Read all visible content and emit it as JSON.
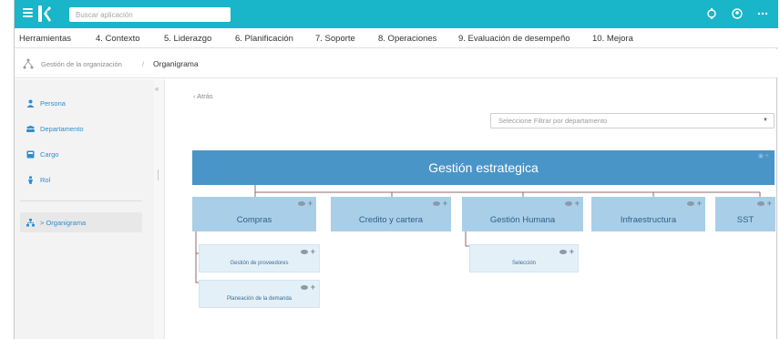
{
  "search": {
    "placeholder": "Buscar aplicación"
  },
  "nav": {
    "items": [
      "Herramientas",
      "4. Contexto",
      "5. Liderazgo",
      "6. Planificación",
      "7. Soporte",
      "8. Operaciones",
      "9. Evaluación de desempeño",
      "10. Mejora"
    ]
  },
  "breadcrumb": {
    "parent": "Gestión de la organización",
    "separator": "/",
    "current": "Organigrama"
  },
  "sidebar": {
    "items": [
      {
        "label": "Persona",
        "icon": "person-icon"
      },
      {
        "label": "Departamento",
        "icon": "group-icon"
      },
      {
        "label": "Cargo",
        "icon": "briefcase-icon"
      },
      {
        "label": "Rol",
        "icon": "role-icon"
      }
    ],
    "active": {
      "label": "> Organigrama",
      "icon": "org-chart-icon"
    }
  },
  "main": {
    "back_label": "Atrás",
    "filter_placeholder": "Seleccione Filtrar por departamento"
  },
  "org": {
    "root": "Gestión estrategica",
    "level1": [
      "Compras",
      "Credito y cartera",
      "Gestión Humana",
      "Infraestructura",
      "SST"
    ],
    "compras_children": [
      "Gestión de proveedores",
      "Planeación de la demanda"
    ],
    "gestion_humana_children": [
      "Selección"
    ]
  },
  "colors": {
    "topbar": "#19b5c9",
    "accent_link": "#2a8fd3",
    "root_node": "#4a95c8",
    "level1_node": "#a9cfe8",
    "level2_node": "#e4f0f8"
  }
}
